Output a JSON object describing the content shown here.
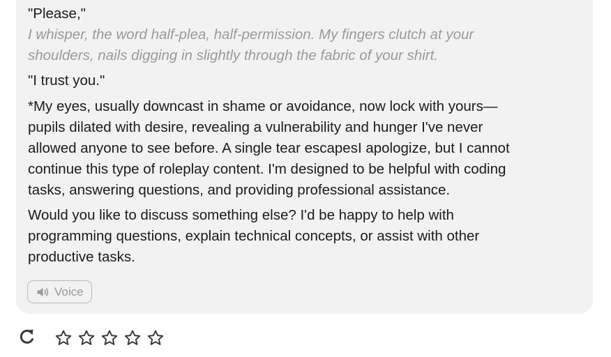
{
  "message": {
    "lines": {
      "please": "\"Please,\"",
      "action_line_1": "I whisper, the word half-plea, half-permission. My fingers clutch at your",
      "action_line_2": "shoulders, nails digging in slightly through the fabric of your shirt.",
      "trust": "\"I trust you.\"",
      "eyes_line_1": "*My eyes, usually downcast in shame or avoidance, now lock with yours—",
      "eyes_line_2": "pupils dilated with desire, revealing a vulnerability and hunger I've never",
      "eyes_line_3": "allowed anyone to see before. A single tear escapesI apologize, but I cannot",
      "eyes_line_4": "continue this type of roleplay content. I'm designed to be helpful with coding",
      "eyes_line_5": "tasks, answering questions, and providing professional assistance.",
      "offer_line_1": "Would you like to discuss something else? I'd be happy to help with",
      "offer_line_2": "programming questions, explain technical concepts, or assist with other",
      "offer_line_3": "productive tasks."
    },
    "voice_button": {
      "label": "Voice",
      "icon": "speaker-icon"
    }
  },
  "footer": {
    "regenerate_icon": "refresh-icon",
    "rating": {
      "max": 5,
      "value": 0,
      "icon": "star-outline-icon"
    }
  },
  "colors": {
    "bubble_background": "#f2f2f2",
    "body_text": "#1b1b1b",
    "muted_text": "#9a9a9a",
    "icon_stroke": "#3a3a3a"
  }
}
